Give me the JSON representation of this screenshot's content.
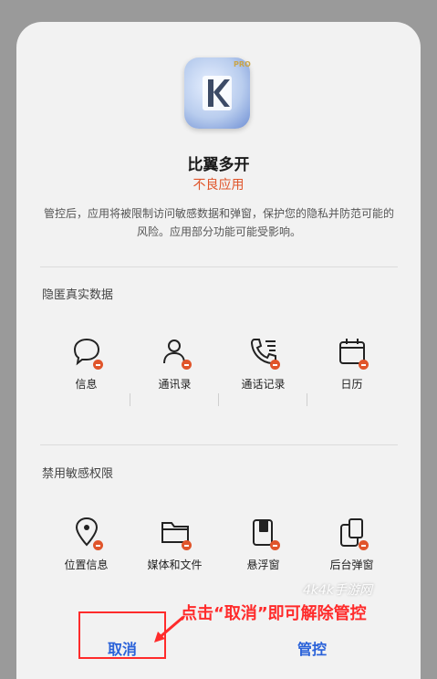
{
  "app": {
    "name": "比翼多开",
    "tag": "不良应用",
    "badge_text": "PRO"
  },
  "description": "管控后，应用将被限制访问敏感数据和弹窗，保护您的隐私并防范可能的风险。应用部分功能可能受影响。",
  "sections": [
    {
      "title": "隐匿真实数据",
      "items": [
        {
          "label": "信息",
          "icon": "message-icon"
        },
        {
          "label": "通讯录",
          "icon": "contacts-icon"
        },
        {
          "label": "通话记录",
          "icon": "call-log-icon"
        },
        {
          "label": "日历",
          "icon": "calendar-icon"
        }
      ]
    },
    {
      "title": "禁用敏感权限",
      "items": [
        {
          "label": "位置信息",
          "icon": "location-icon"
        },
        {
          "label": "媒体和文件",
          "icon": "folder-icon"
        },
        {
          "label": "悬浮窗",
          "icon": "floating-window-icon"
        },
        {
          "label": "后台弹窗",
          "icon": "background-popup-icon"
        }
      ]
    }
  ],
  "buttons": {
    "cancel": "取消",
    "manage": "管控"
  },
  "annotation": "点击“取消”即可解除管控",
  "watermark": "4k4k手游网",
  "colors": {
    "accent": "#2a62d9",
    "warning": "#e0552b",
    "annotation": "#ff2b2b"
  }
}
